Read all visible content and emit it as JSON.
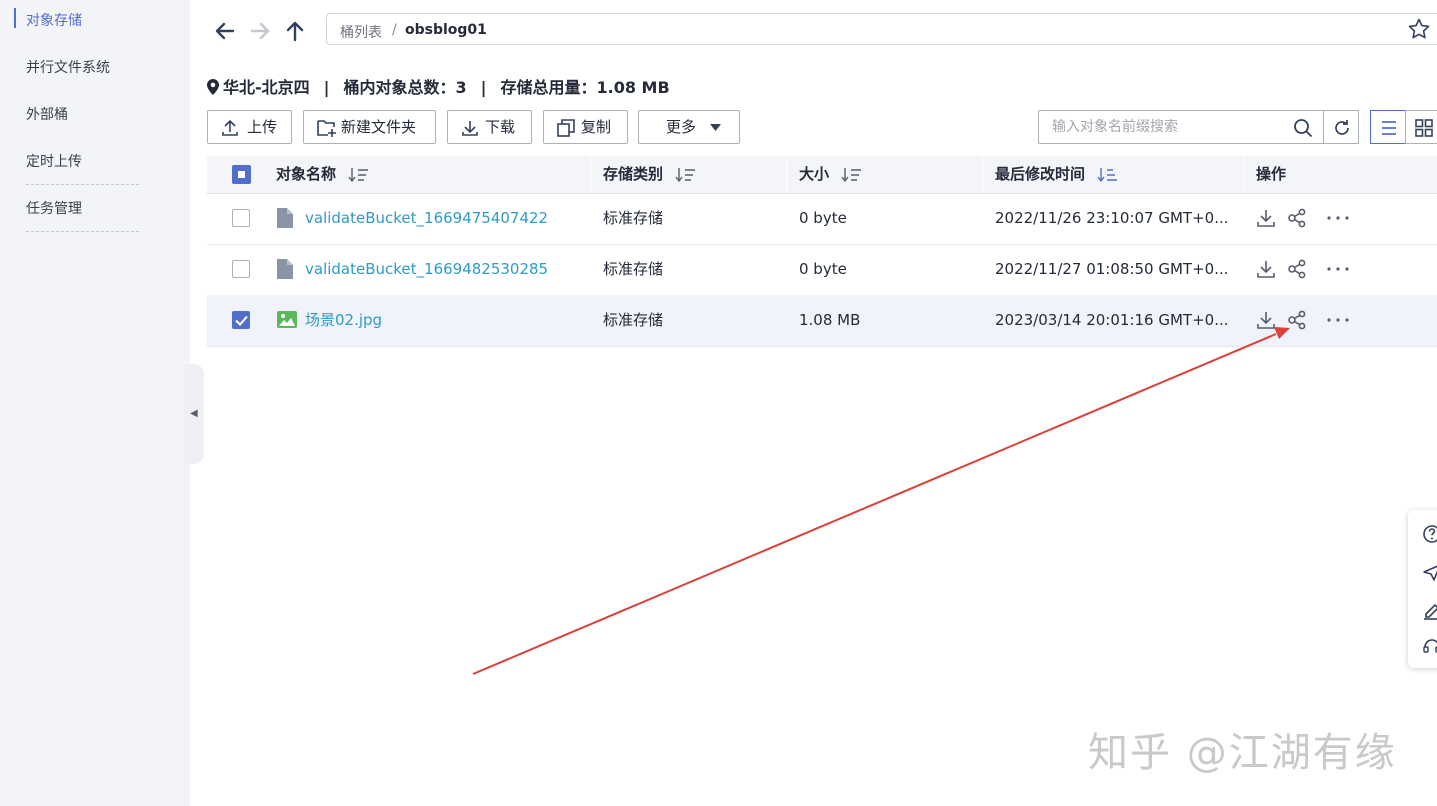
{
  "sidebar": {
    "items": [
      {
        "label": "对象存储",
        "active": true
      },
      {
        "label": "并行文件系统",
        "active": false
      },
      {
        "label": "外部桶",
        "active": false
      },
      {
        "label": "定时上传",
        "active": false
      },
      {
        "label": "任务管理",
        "active": false
      }
    ]
  },
  "nav": {
    "breadcrumb_root": "桶列表",
    "breadcrumb_sep": "/",
    "breadcrumb_current": "obsblog01"
  },
  "summary": {
    "region": "华北-北京四",
    "sep": "|",
    "object_count": "桶内对象总数：3",
    "storage_used": "存储总用量：1.08 MB"
  },
  "toolbar": {
    "upload": "上传",
    "new_folder": "新建文件夹",
    "download": "下载",
    "copy": "复制",
    "more": "更多",
    "search_placeholder": "输入对象名前缀搜索"
  },
  "table": {
    "headers": {
      "name": "对象名称",
      "storage_class": "存储类别",
      "size": "大小",
      "modified": "最后修改时间",
      "actions": "操作"
    },
    "rows": [
      {
        "name": "validateBucket_1669475407422",
        "type": "file",
        "storage_class": "标准存储",
        "size": "0 byte",
        "modified": "2022/11/26 23:10:07 GMT+0...",
        "checked": false
      },
      {
        "name": "validateBucket_1669482530285",
        "type": "file",
        "storage_class": "标准存储",
        "size": "0 byte",
        "modified": "2022/11/27 01:08:50 GMT+0...",
        "checked": false
      },
      {
        "name": "场景02.jpg",
        "type": "image",
        "storage_class": "标准存储",
        "size": "1.08 MB",
        "modified": "2023/03/14 20:01:16 GMT+0...",
        "checked": true
      }
    ],
    "row_actions": [
      "download-icon",
      "share-icon",
      "more-dots-icon"
    ]
  },
  "colors": {
    "accent": "#526ecc",
    "link": "#2e9bc7",
    "annotation_arrow": "#d9413a"
  },
  "watermark": "知乎 @江湖有缘"
}
